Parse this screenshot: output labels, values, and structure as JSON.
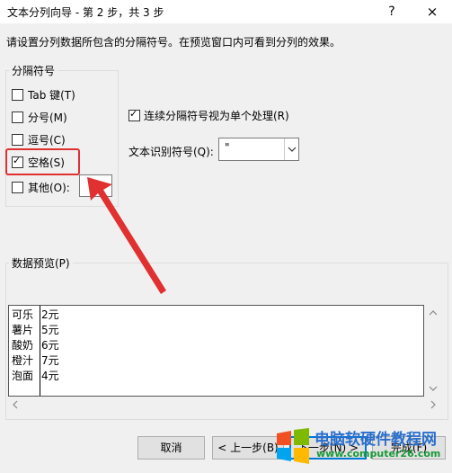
{
  "window": {
    "title": "文本分列向导 - 第 2 步，共 3 步",
    "help_label": "?",
    "close_label": "×"
  },
  "instruction": "请设置分列数据所包含的分隔符号。在预览窗口内可看到分列的效果。",
  "delimiters": {
    "group_label": "分隔符号",
    "tab": {
      "label": "Tab 键(T)",
      "checked": false
    },
    "semicolon": {
      "label": "分号(M)",
      "checked": false
    },
    "comma": {
      "label": "逗号(C)",
      "checked": false
    },
    "space": {
      "label": "空格(S)",
      "checked": true
    },
    "other": {
      "label": "其他(O):",
      "checked": false,
      "value": ""
    }
  },
  "consecutive": {
    "label": "连续分隔符号视为单个处理(R)",
    "checked": true
  },
  "text_qualifier": {
    "label": "文本识别符号(Q):",
    "value": "\""
  },
  "preview": {
    "label": "数据预览(P)",
    "rows": [
      [
        "可乐",
        "2元"
      ],
      [
        "薯片",
        "5元"
      ],
      [
        "酸奶",
        "6元"
      ],
      [
        "橙汁",
        "7元"
      ],
      [
        "泡面",
        "4元"
      ]
    ]
  },
  "buttons": {
    "cancel": "取消",
    "back": "< 上一步(B)",
    "next": "下一步(N) >",
    "finish": "完成(F)"
  },
  "watermark": {
    "title": "电脑软硬件教程网",
    "url": "www.computer26.com"
  },
  "colors": {
    "highlight": "#e03030",
    "arrow": "#e03030",
    "watermark_blue": "#2b6fcb",
    "watermark_green": "#1a9a3a"
  }
}
